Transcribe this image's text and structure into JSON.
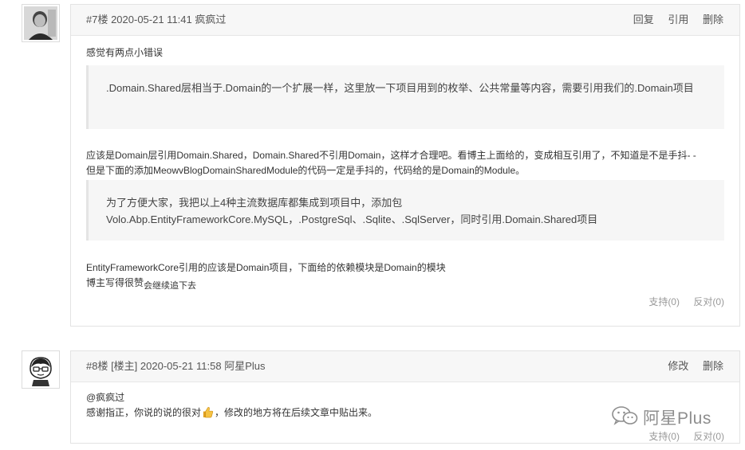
{
  "comments": [
    {
      "meta": "#7楼 2020-05-21 11:41 疯疯过",
      "actions": [
        "回复",
        "引用",
        "删除"
      ],
      "intro": "感觉有两点小错误",
      "quote1": ".Domain.Shared层相当于.Domain的一个扩展一样，这里放一下项目用到的枚举、公共常量等内容，需要引用我们的.Domain项目",
      "para1_line1": "应该是Domain层引用Domain.Shared，Domain.Shared不引用Domain，这样才合理吧。看博主上面给的，变成相互引用了，不知道是不是手抖- -",
      "para1_line2": "但是下面的添加MeowvBlogDomainSharedModule的代码一定是手抖的，代码给的是Domain的Module。",
      "quote2_line1": "为了方便大家，我把以上4种主流数据库都集成到项目中，添加包",
      "quote2_line2": "Volo.Abp.EntityFrameworkCore.MySQL，.PostgreSql、.Sqlite、.SqlServer，同时引用.Domain.Shared项目",
      "para2_line1": "EntityFrameworkCore引用的应该是Domain项目，下面给的依赖模块是Domain的模块",
      "para2_line2": "博主写得很赞",
      "para2_line2_suffix": "会继续追下去",
      "support": "支持(0)",
      "oppose": "反对(0)"
    },
    {
      "meta": "#8楼 [楼主] 2020-05-21 11:58 阿星Plus",
      "actions": [
        "修改",
        "删除"
      ],
      "mention": "@疯疯过",
      "reply_before_emoji": "感谢指正，你说的说的很对",
      "thumbs_icon": "thumbs-up-icon",
      "reply_after_emoji": "，修改的地方将在后续文章中贴出来。",
      "support": "支持(0)",
      "oppose": "反对(0)"
    }
  ],
  "watermark": {
    "icon": "wechat-icon",
    "text": "阿星Plus"
  },
  "colors": {
    "header_bg": "#f7f7f7",
    "quote_bg": "#f6f6f6",
    "border": "#e3e3e3",
    "muted": "#999999"
  }
}
